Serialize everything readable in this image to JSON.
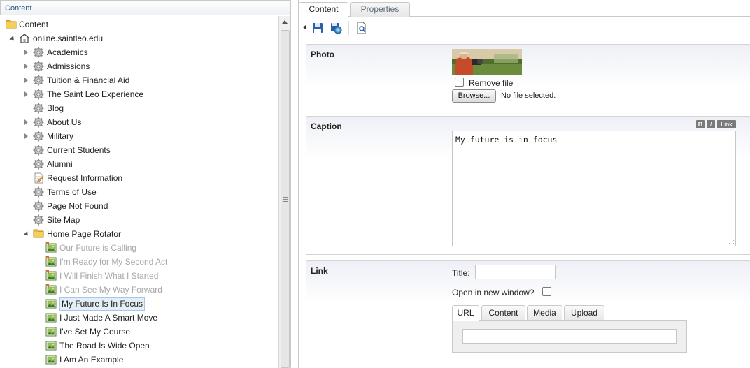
{
  "left_panel": {
    "header": "Content",
    "tree": {
      "root": "Content",
      "site": "online.saintleo.edu",
      "pages": [
        {
          "label": "Academics",
          "expandable": true
        },
        {
          "label": "Admissions",
          "expandable": true
        },
        {
          "label": "Tuition & Financial Aid",
          "expandable": true
        },
        {
          "label": "The Saint Leo Experience",
          "expandable": true
        },
        {
          "label": "Blog",
          "expandable": false
        },
        {
          "label": "About Us",
          "expandable": true
        },
        {
          "label": "Military",
          "expandable": true
        },
        {
          "label": "Current Students",
          "expandable": false
        },
        {
          "label": "Alumni",
          "expandable": false
        },
        {
          "label": "Request Information",
          "expandable": false,
          "icon": "form-page-icon"
        },
        {
          "label": "Terms of Use",
          "expandable": false
        },
        {
          "label": "Page Not Found",
          "expandable": false
        },
        {
          "label": "Site Map",
          "expandable": false
        }
      ],
      "folder": "Home Page Rotator",
      "rotator_items": [
        {
          "label": "Our Future is Calling",
          "state": "unpublished"
        },
        {
          "label": "I'm Ready for My Second Act",
          "state": "unpublished"
        },
        {
          "label": "I Will Finish What I Started",
          "state": "unpublished"
        },
        {
          "label": "I Can See My Way Forward",
          "state": "unpublished"
        },
        {
          "label": "My Future Is In Focus",
          "state": "selected"
        },
        {
          "label": "I Just Made A Smart Move",
          "state": "published"
        },
        {
          "label": "I've Set My Course",
          "state": "published"
        },
        {
          "label": "The Road Is Wide Open",
          "state": "published"
        },
        {
          "label": "I Am An Example",
          "state": "published"
        }
      ]
    }
  },
  "right_panel": {
    "tabs": [
      "Content",
      "Properties"
    ],
    "active_tab": "Content",
    "toolbar": [
      "save-icon",
      "save-and-publish-icon",
      "preview-icon"
    ],
    "photo": {
      "label": "Photo",
      "remove_label": "Remove file",
      "remove_checked": false,
      "browse_label": "Browse...",
      "file_status": "No file selected."
    },
    "caption": {
      "label": "Caption",
      "format_buttons": [
        "B",
        "I",
        "Link"
      ],
      "value": "My future is in focus"
    },
    "link": {
      "label": "Link",
      "title_label": "Title:",
      "title_value": "",
      "new_window_label": "Open in new window?",
      "new_window_checked": false,
      "tabs": [
        "URL",
        "Content",
        "Media",
        "Upload"
      ],
      "active_tab": "URL",
      "url_value": ""
    }
  },
  "colors": {
    "selected_bg": "#e3eef8",
    "disabled_text": "#a8a8a8",
    "header_text": "#1f4f7a"
  }
}
